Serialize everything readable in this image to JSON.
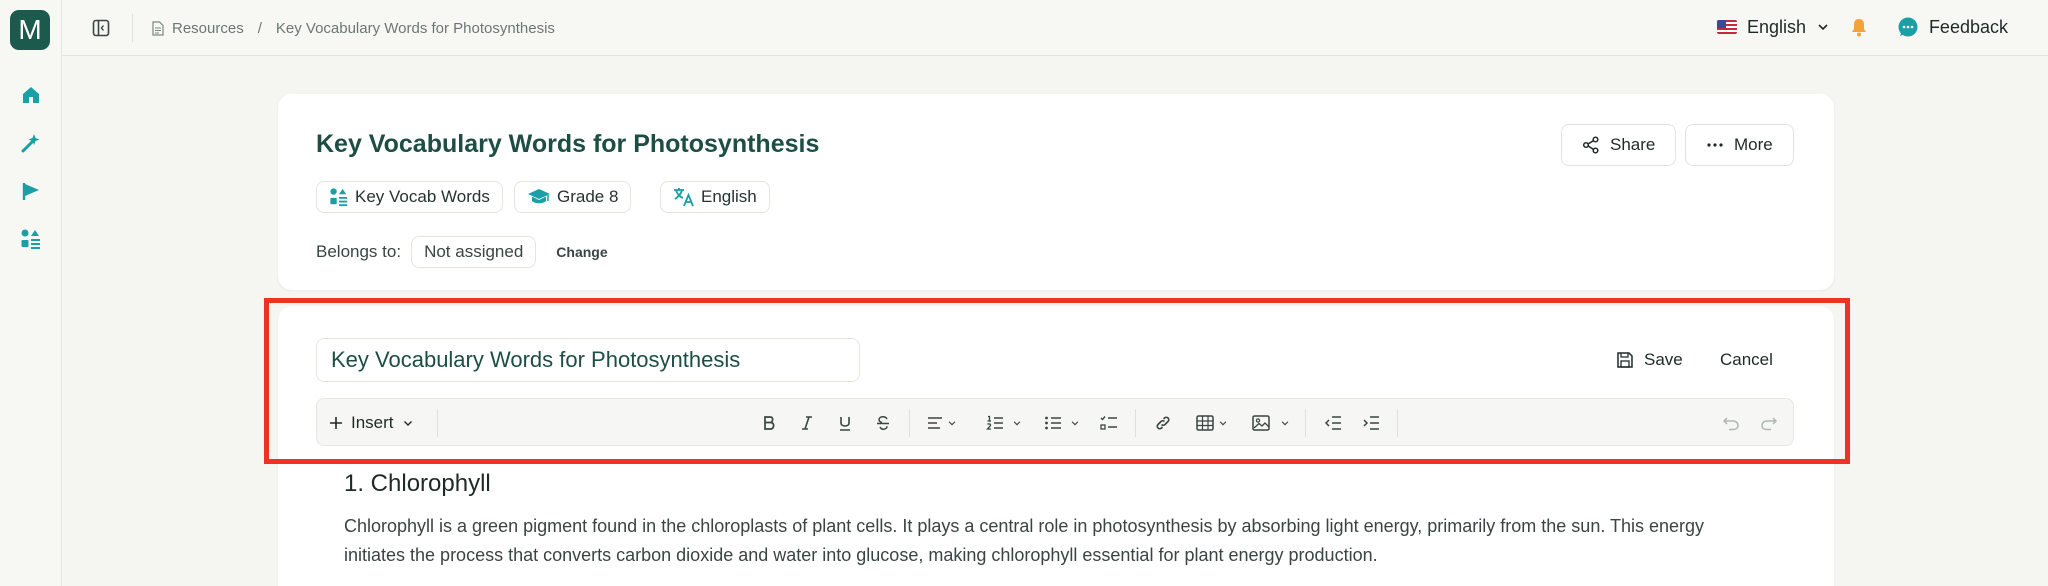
{
  "app": {
    "logo_letter": "M"
  },
  "rail": {
    "items": [
      {
        "icon": "home-icon"
      },
      {
        "icon": "magic-wand-icon"
      },
      {
        "icon": "flag-icon"
      },
      {
        "icon": "resources-icon"
      }
    ]
  },
  "breadcrumb": {
    "root": "Resources",
    "separator": "/",
    "current": "Key Vocabulary Words for Photosynthesis"
  },
  "topbar": {
    "language": "English",
    "feedback": "Feedback"
  },
  "resource": {
    "title": "Key Vocabulary Words for Photosynthesis",
    "share": "Share",
    "more": "More",
    "tags": [
      "Key Vocab Words",
      "Grade 8",
      "English"
    ],
    "belongs_label": "Belongs to:",
    "belongs_value": "Not assigned",
    "change": "Change"
  },
  "editor": {
    "title_value": "Key Vocabulary Words for Photosynthesis",
    "save": "Save",
    "cancel": "Cancel",
    "insert": "Insert"
  },
  "document": {
    "heading": "1. Chlorophyll",
    "paragraph": "Chlorophyll is a green pigment found in the chloroplasts of plant cells. It plays a central role in photosynthesis by absorbing light energy, primarily from the sun. This energy initiates the process that converts carbon dioxide and water into glucose, making chlorophyll essential for plant energy production."
  },
  "colors": {
    "brand": "#1d5a4e",
    "accent": "#1a9fa6",
    "highlight": "#ee3324",
    "bell": "#f2a33a"
  }
}
